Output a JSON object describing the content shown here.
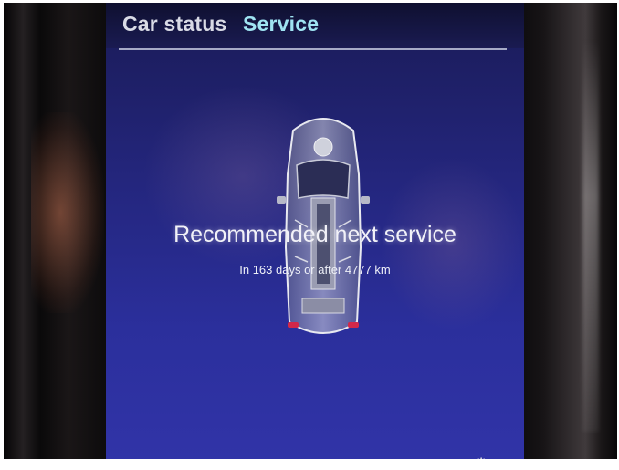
{
  "tabs": [
    {
      "label": "Car status",
      "active": false
    },
    {
      "label": "Service",
      "active": true
    }
  ],
  "service": {
    "title": "Recommended next service",
    "detail": "In 163 days or after 4777 km"
  },
  "colors": {
    "screen_bg": "#23257a",
    "active_tab": "#9fe4f2",
    "inactive_tab": "#d9dbe6",
    "text": "#f2f2f8"
  },
  "icons": {
    "car": "car-top-view-icon",
    "settings": "gear-icon"
  }
}
